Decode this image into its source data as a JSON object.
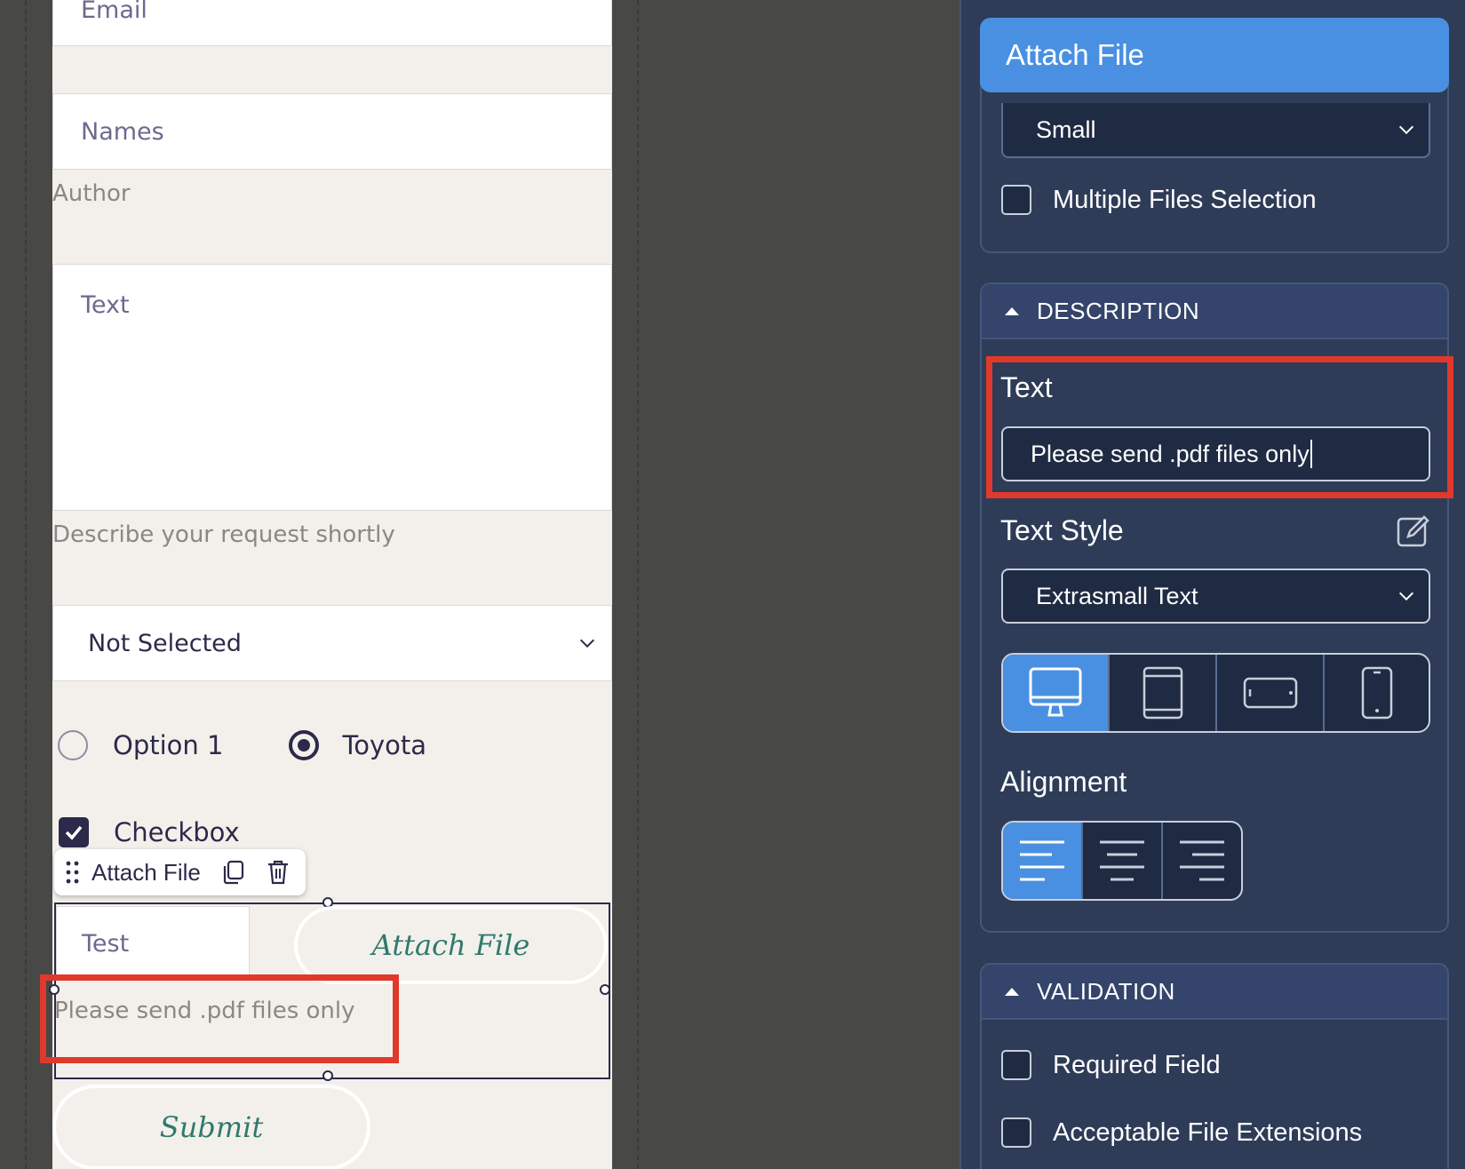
{
  "form": {
    "email_placeholder": "Email",
    "names_placeholder": "Names",
    "author_caption": "Author",
    "text_placeholder": "Text",
    "text_caption": "Describe your request shortly",
    "select_value": "Not Selected",
    "radio_option_1": "Option 1",
    "radio_option_2": "Toyota",
    "checkbox_label": "Checkbox",
    "toolbar_label": "Attach File",
    "test_field_value": "Test",
    "attach_button": "Attach File",
    "attach_description": "Please send .pdf files only",
    "submit_button": "Submit"
  },
  "panel": {
    "title": "Attach File",
    "size_select": "Small",
    "multiple_files": "Multiple Files Selection",
    "description_header": "DESCRIPTION",
    "text_label": "Text",
    "text_value": "Please send .pdf files only",
    "text_style_label": "Text Style",
    "text_style_value": "Extrasmall Text",
    "device_options": [
      "desktop",
      "tablet-portrait",
      "tablet-landscape",
      "mobile"
    ],
    "device_active": "desktop",
    "alignment_label": "Alignment",
    "alignment_active": "left",
    "validation_header": "VALIDATION",
    "required_field": "Required Field",
    "acceptable_extensions": "Acceptable File Extensions"
  },
  "colors": {
    "accent": "#4a90e2",
    "panel_bg": "#2e3c58",
    "highlight": "#e0392b",
    "button_text": "#2f7a6d"
  }
}
